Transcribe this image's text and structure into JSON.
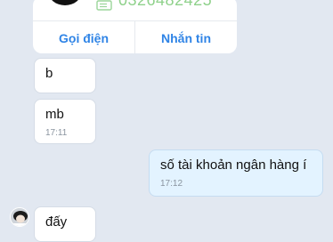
{
  "contact_card": {
    "phone": "0326482425",
    "actions": [
      {
        "label": "Gọi điện"
      },
      {
        "label": "Nhắn tin"
      }
    ]
  },
  "messages": [
    {
      "text": "b",
      "time": ""
    },
    {
      "text": "mb",
      "time": "17:11"
    },
    {
      "text": "số tài khoản ngân hàng í",
      "time": "17:12"
    },
    {
      "text": "đấy",
      "time": ""
    }
  ],
  "colors": {
    "background": "#e2e8f1",
    "action_blue": "#2f84e6",
    "outgoing_bubble": "#e3f3ff",
    "incoming_bubble": "#ffffff",
    "phone_green": "#8fd18b"
  },
  "icons": {
    "phone": "phone-book-icon"
  }
}
